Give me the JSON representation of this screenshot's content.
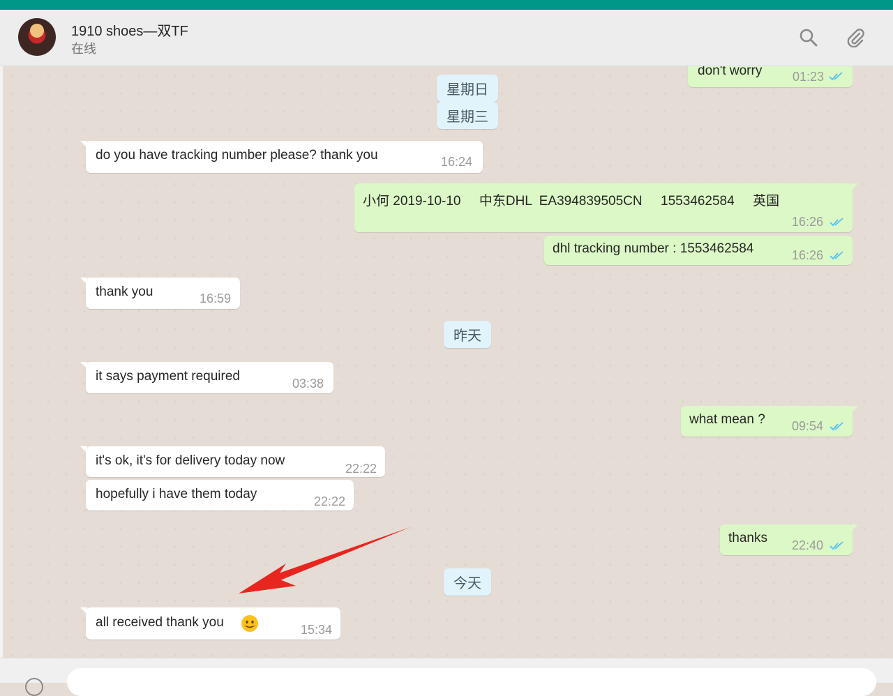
{
  "header": {
    "contact_name": "1910 shoes—双TF",
    "status": "在线",
    "icons": [
      "search-icon",
      "paperclip-icon"
    ]
  },
  "date_dividers": {
    "sunday": "星期日",
    "wednesday": "星期三",
    "yesterday": "昨天",
    "today": "今天"
  },
  "messages": {
    "m1": {
      "direction": "out",
      "text": "don't worry",
      "time": "01:23",
      "read": true
    },
    "m2": {
      "direction": "in",
      "text": "do you have tracking number please? thank you",
      "time": "16:24"
    },
    "m3": {
      "direction": "out",
      "text": "小何 2019-10-10     中东DHL  EA394839505CN     1553462584     英国",
      "time": "16:26",
      "read": true
    },
    "m4": {
      "direction": "out",
      "text": "dhl tracking number : 1553462584",
      "time": "16:26",
      "read": true
    },
    "m5": {
      "direction": "in",
      "text": "thank you",
      "time": "16:59"
    },
    "m6": {
      "direction": "in",
      "text": "it says payment required",
      "time": "03:38"
    },
    "m7": {
      "direction": "out",
      "text": "what mean ?",
      "time": "09:54",
      "read": true
    },
    "m8": {
      "direction": "in",
      "text": "it's ok, it's for delivery today now",
      "time": "22:22"
    },
    "m9": {
      "direction": "in",
      "text": "hopefully i have them today",
      "time": "22:22"
    },
    "m10": {
      "direction": "out",
      "text": "thanks",
      "time": "22:40",
      "read": true
    },
    "m11": {
      "direction": "in",
      "text": "all received thank you",
      "emoji": "smiling-face-emoji",
      "time": "15:34"
    }
  },
  "annotation": {
    "type": "arrow",
    "color": "#e8261f"
  },
  "colors": {
    "topbar": "#009688",
    "incoming_bubble": "#ffffff",
    "outgoing_bubble": "#dcf8c6",
    "read_ticks": "#4fc3f7",
    "date_pill": "#e1f3fb"
  }
}
